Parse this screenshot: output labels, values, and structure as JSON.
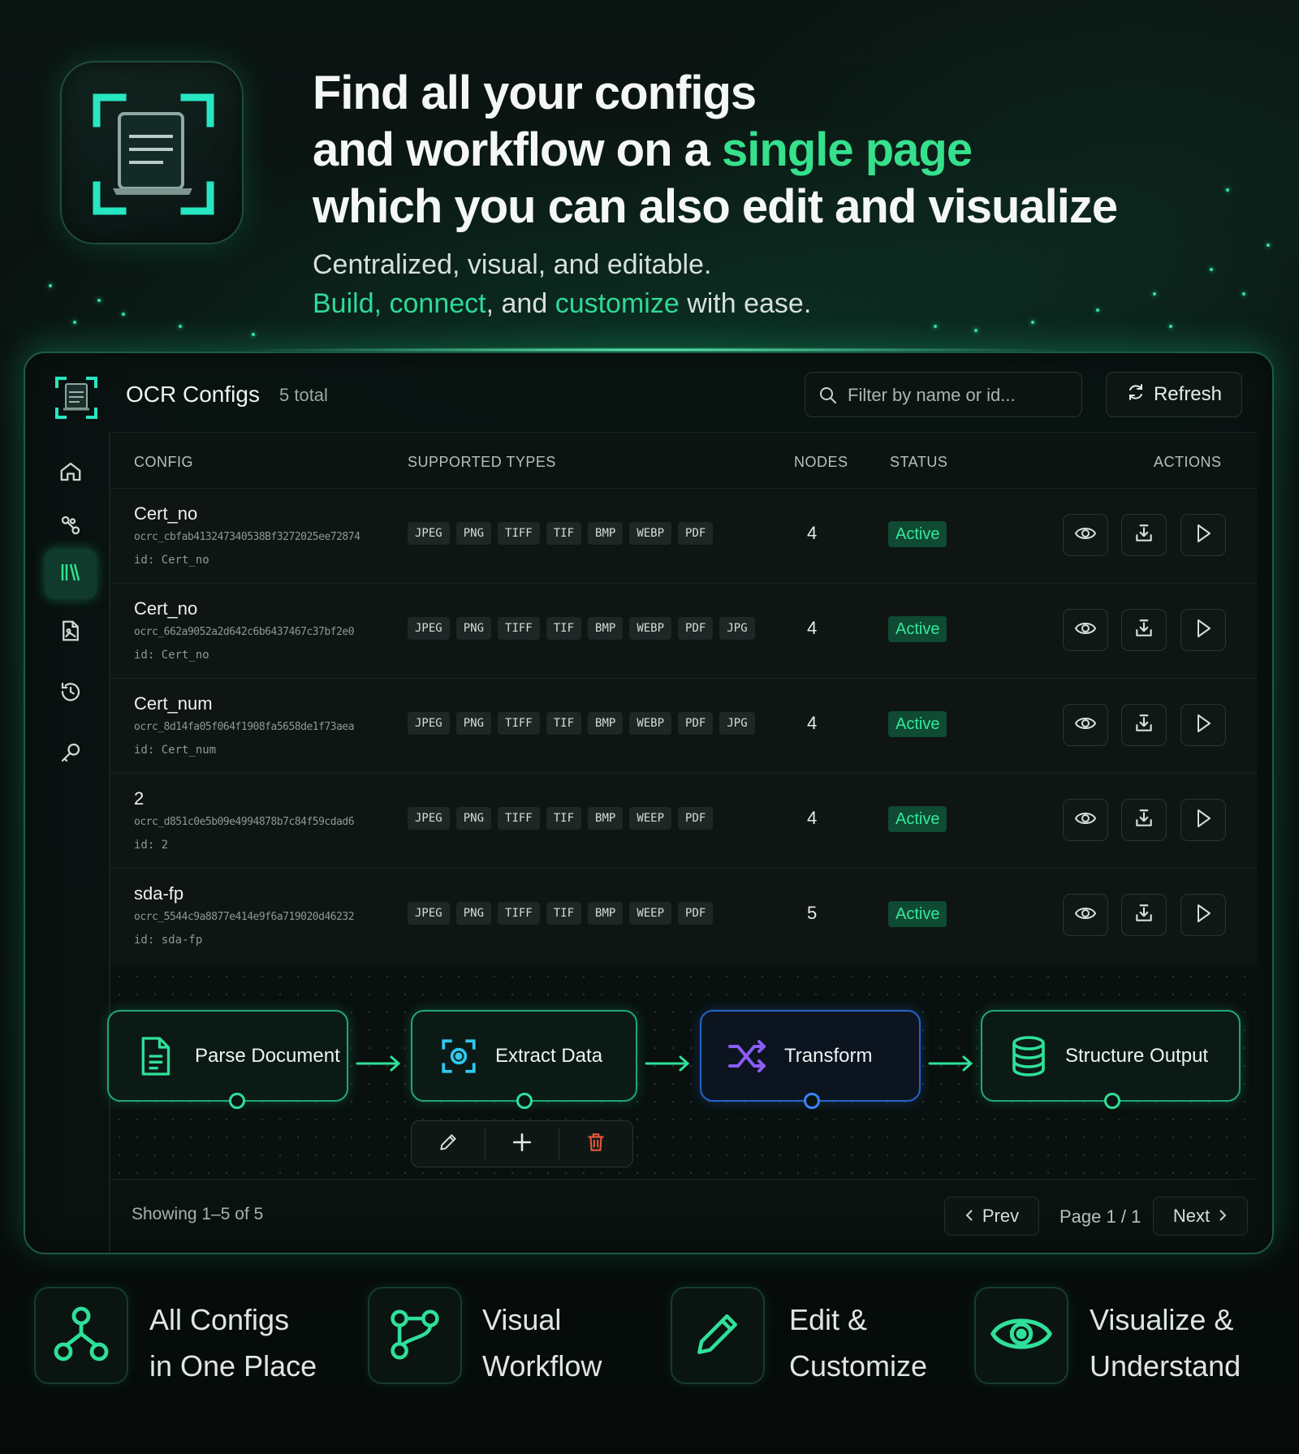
{
  "hero": {
    "title_line1": "Find all your configs",
    "title_line2_pre": "and workflow on a ",
    "title_line2_accent": "single page",
    "title_line3": "which you can also edit and visualize",
    "sub_line1": "Centralized, visual, and editable.",
    "sub_build": "Build",
    "sub_comma1": ", ",
    "sub_connect": "connect",
    "sub_and": ", and ",
    "sub_customize": "customize",
    "sub_end": " with ease."
  },
  "header": {
    "title": "OCR Configs",
    "count": "5 total",
    "search_placeholder": "Filter by name or id...",
    "refresh_label": "Refresh"
  },
  "sidebar": {
    "items": [
      {
        "icon": "home-icon"
      },
      {
        "icon": "workflow-icon"
      },
      {
        "icon": "library-icon",
        "active": true
      },
      {
        "icon": "document-image-icon"
      },
      {
        "icon": "history-icon"
      },
      {
        "icon": "key-icon"
      }
    ]
  },
  "table": {
    "columns": [
      "CONFIG",
      "SUPPORTED TYPES",
      "NODES",
      "STATUS",
      "ACTIONS"
    ],
    "rows": [
      {
        "name": "Cert_no",
        "ocr_id": "ocrc_cbfab413247340538Bf3272025ee72874",
        "id": "id: Cert_no",
        "types": [
          "JPEG",
          "PNG",
          "TIFF",
          "TIF",
          "BMP",
          "WEBP",
          "PDF"
        ],
        "nodes": "4",
        "status": "Active"
      },
      {
        "name": "Cert_no",
        "ocr_id": "ocrc_662a9052a2d642c6b6437467c37bf2e0",
        "id": "id: Cert_no",
        "types": [
          "JPEG",
          "PNG",
          "TIFF",
          "TIF",
          "BMP",
          "WEBP",
          "PDF",
          "JPG"
        ],
        "nodes": "4",
        "status": "Active"
      },
      {
        "name": "Cert_num",
        "ocr_id": "ocrc_8d14fa05f064f1908fa5658de1f73aea",
        "id": "id: Cert_num",
        "types": [
          "JPEG",
          "PNG",
          "TIFF",
          "TIF",
          "BMP",
          "WEBP",
          "PDF",
          "JPG"
        ],
        "nodes": "4",
        "status": "Active"
      },
      {
        "name": "2",
        "ocr_id": "ocrc_d851c0e5b09e4994878b7c84f59cdad6",
        "id": "id: 2",
        "types": [
          "JPEG",
          "PNG",
          "TIFF",
          "TIF",
          "BMP",
          "WEEP",
          "PDF"
        ],
        "nodes": "4",
        "status": "Active"
      },
      {
        "name": "sda-fp",
        "ocr_id": "ocrc_5544c9a8877e414e9f6a719020d46232",
        "id": "id: sda-fp",
        "types": [
          "JPEG",
          "PNG",
          "TIFF",
          "TIF",
          "BMP",
          "WEEP",
          "PDF"
        ],
        "nodes": "5",
        "status": "Active"
      }
    ],
    "row_actions": [
      "eye-icon",
      "download-icon",
      "play-icon"
    ]
  },
  "workflow": {
    "nodes": [
      {
        "label": "Parse Document",
        "icon": "file-icon"
      },
      {
        "label": "Extract Data",
        "icon": "scan-icon"
      },
      {
        "label": "Transform",
        "icon": "shuffle-icon"
      },
      {
        "label": "Structure Output",
        "icon": "database-icon"
      }
    ],
    "toolbar": [
      "pencil-icon",
      "plus-icon",
      "trash-icon"
    ]
  },
  "footer": {
    "showing": "Showing 1–5 of 5",
    "prev": "Prev",
    "page": "Page 1 / 1",
    "next": "Next"
  },
  "features": [
    {
      "line1": "All Configs",
      "line2": "in One Place",
      "icon": "hierarchy-icon"
    },
    {
      "line1": "Visual",
      "line2": "Workflow",
      "icon": "git-branch-icon"
    },
    {
      "line1": "Edit &",
      "line2": "Customize",
      "icon": "pencil-icon"
    },
    {
      "line1": "Visualize &",
      "line2": "Understand",
      "icon": "eye-icon"
    }
  ],
  "colors": {
    "accent": "#36e08c",
    "status_active_bg": "#0f4a33",
    "status_active_text": "#34e89b",
    "transform_border": "#2563c9",
    "transform_icon": "#8b5cf6",
    "delete_icon": "#e0573a"
  }
}
